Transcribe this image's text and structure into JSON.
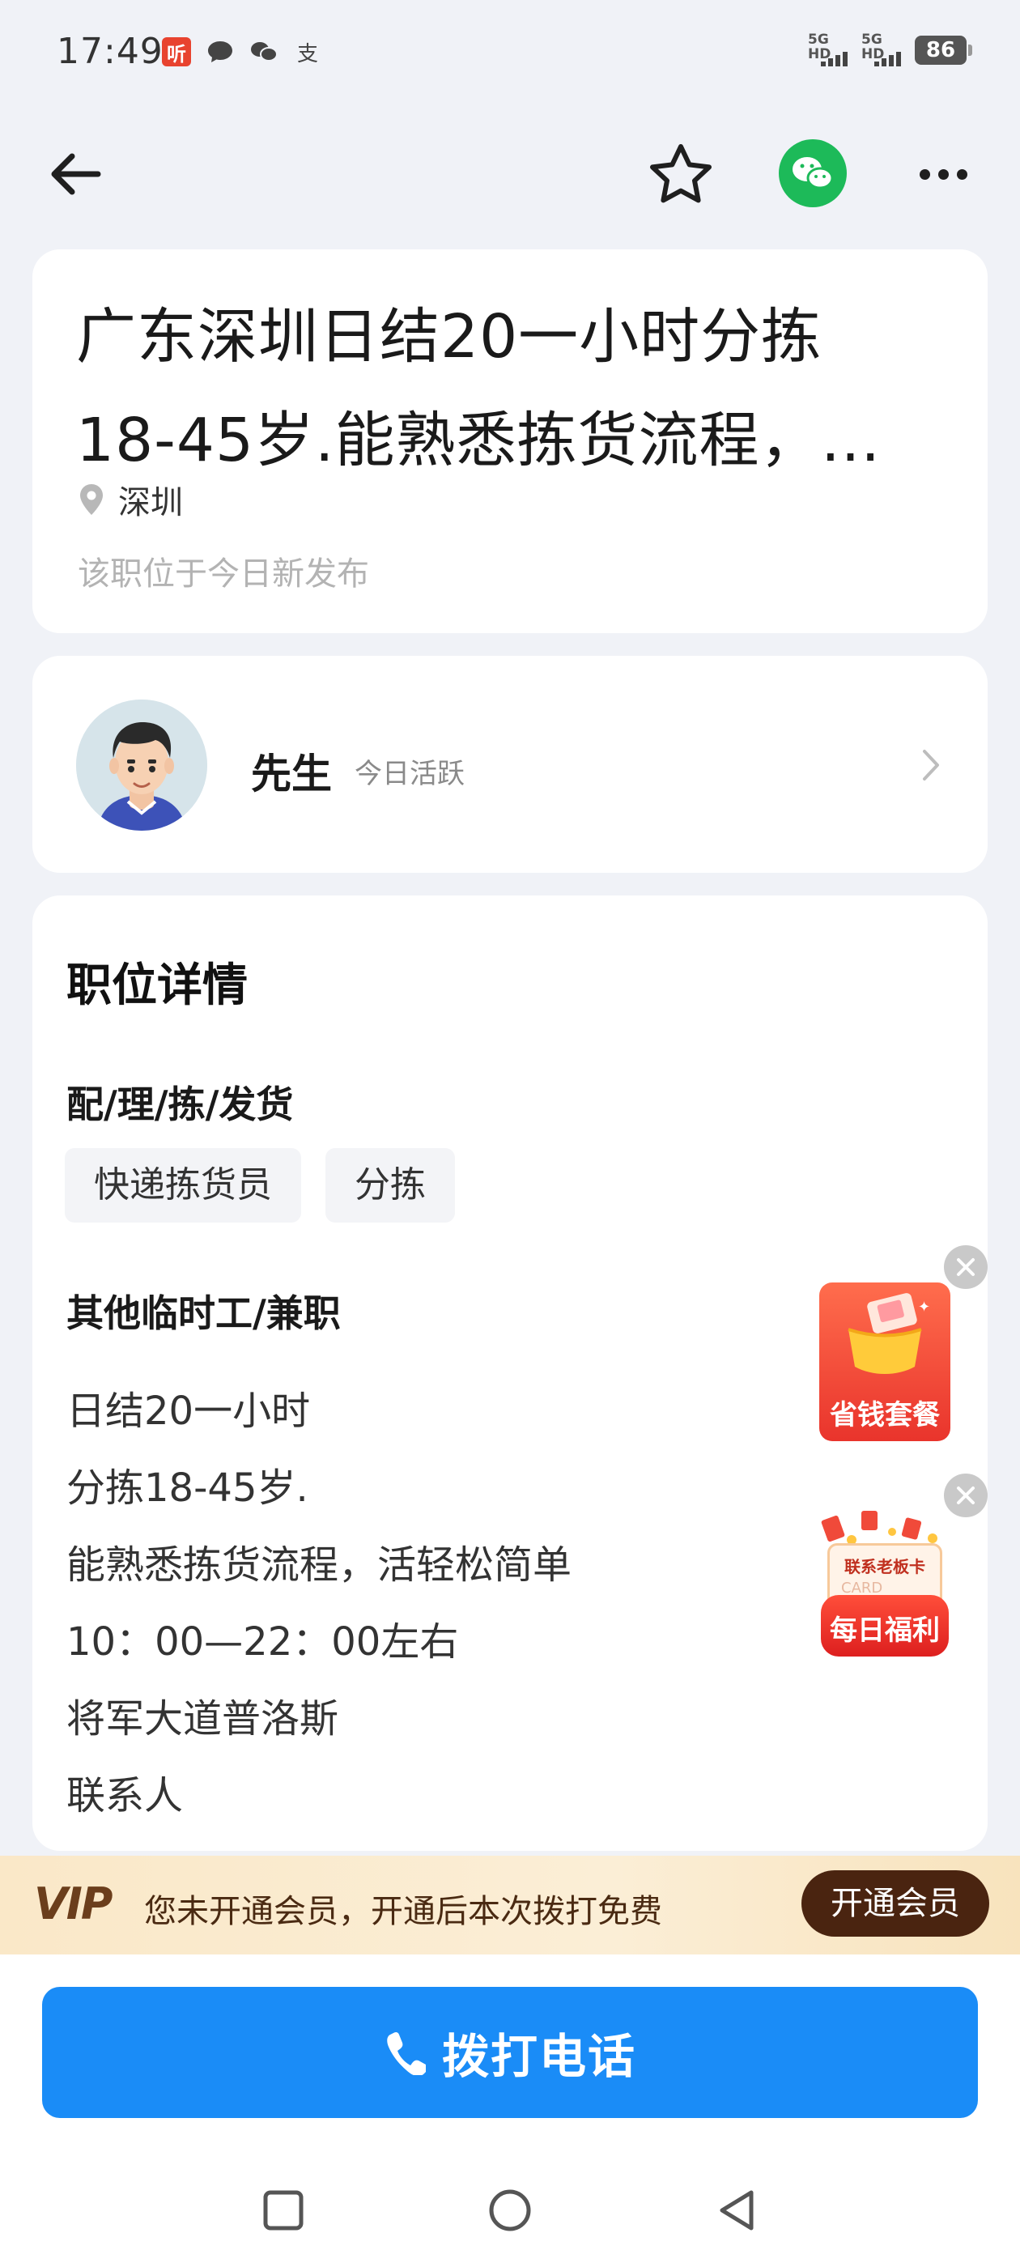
{
  "status_bar": {
    "time": "17:49",
    "app_icons": [
      {
        "name": "listen-app-icon",
        "glyph": "听"
      },
      {
        "name": "message-icon",
        "glyph": "●"
      },
      {
        "name": "wechat-notify-icon",
        "glyph": "◎"
      },
      {
        "name": "alipay-icon",
        "glyph": "支"
      }
    ],
    "signal_1": "5G HD",
    "signal_2": "5G HD",
    "battery": "86"
  },
  "header": {
    "back_icon": "arrow-left",
    "favorite_icon": "star-outline",
    "share_icon": "wechat",
    "more_icon": "ellipsis",
    "wechat_color": "#1dba59"
  },
  "job": {
    "title_line1": "广东深圳日结20一小时分拣",
    "title_line2": "18-45岁.能熟悉拣货流程，…",
    "location": "深圳",
    "publish_note": "该职位于今日新发布"
  },
  "boss": {
    "name": "先生",
    "active_status": "今日活跃"
  },
  "detail": {
    "section_title": "职位详情",
    "category_1": "配/理/拣/发货",
    "tags": [
      "快递拣货员",
      "分拣"
    ],
    "category_2": "其他临时工/兼职",
    "description_lines": [
      "日结20一小时",
      "分拣18-45岁.",
      "能熟悉拣货流程，活轻松简单",
      "10：00—22：00左右",
      "将军大道普洛斯",
      "联系人"
    ]
  },
  "ads": {
    "ad1_label": "省钱套餐",
    "ad2_top_label": "联系老板卡",
    "ad2_card_label": "CARD",
    "ad2_label": "每日福利"
  },
  "vip": {
    "logo": "VIP",
    "message": "您未开通会员，开通后本次拨打免费",
    "button": "开通会员"
  },
  "call": {
    "label": "拨打电话",
    "color": "#1a8cf7"
  },
  "nav": {
    "recent_icon": "square",
    "home_icon": "circle",
    "back_icon": "triangle-left"
  }
}
